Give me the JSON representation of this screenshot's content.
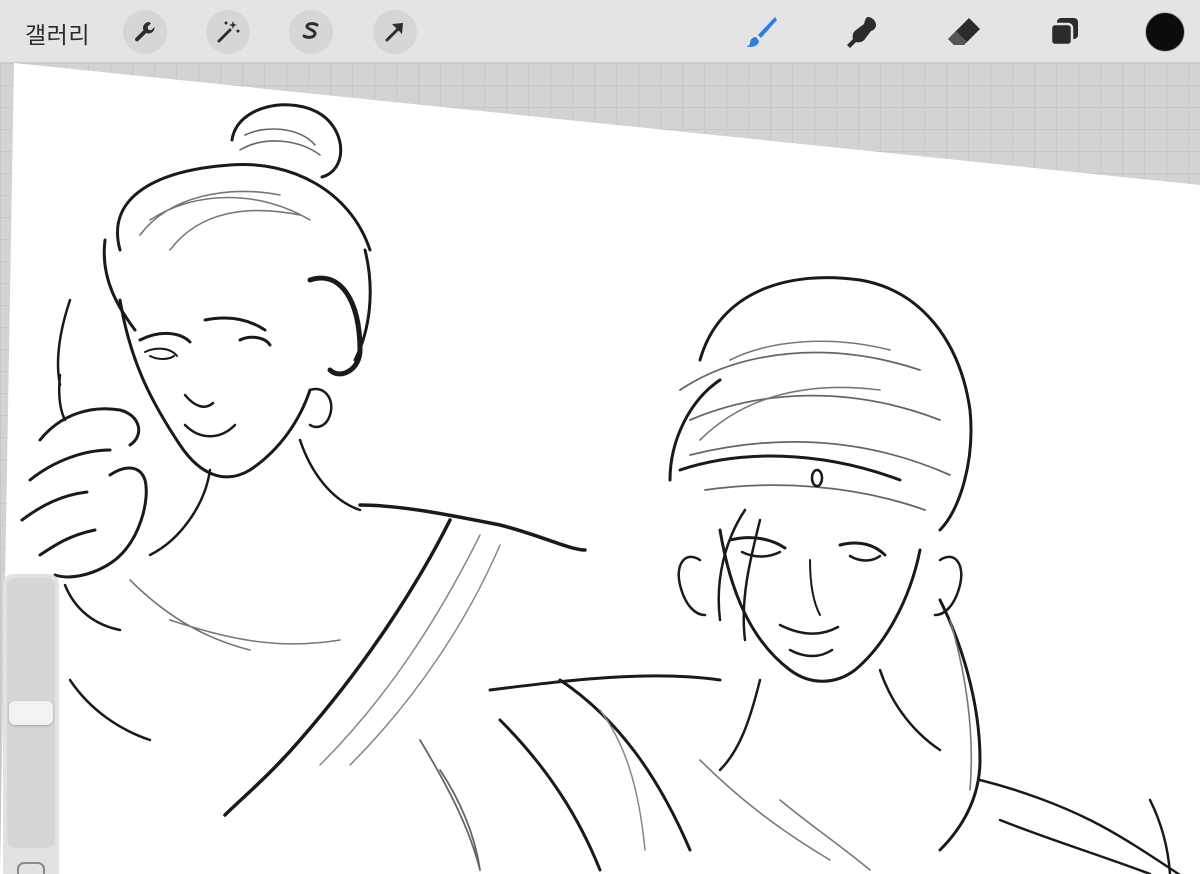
{
  "toolbar": {
    "gallery_label": "갤러리",
    "left_tools": [
      "wrench-icon",
      "magic-wand-icon",
      "selection-s-icon",
      "transform-arrow-icon"
    ],
    "right_tools": [
      "brush-icon",
      "smudge-icon",
      "eraser-icon",
      "layers-icon"
    ],
    "active_tool": "brush-icon",
    "active_color": "#0c0c0c",
    "accent_color": "#2f7de1"
  },
  "sidebar": {
    "brush_size_level": 0.5
  }
}
